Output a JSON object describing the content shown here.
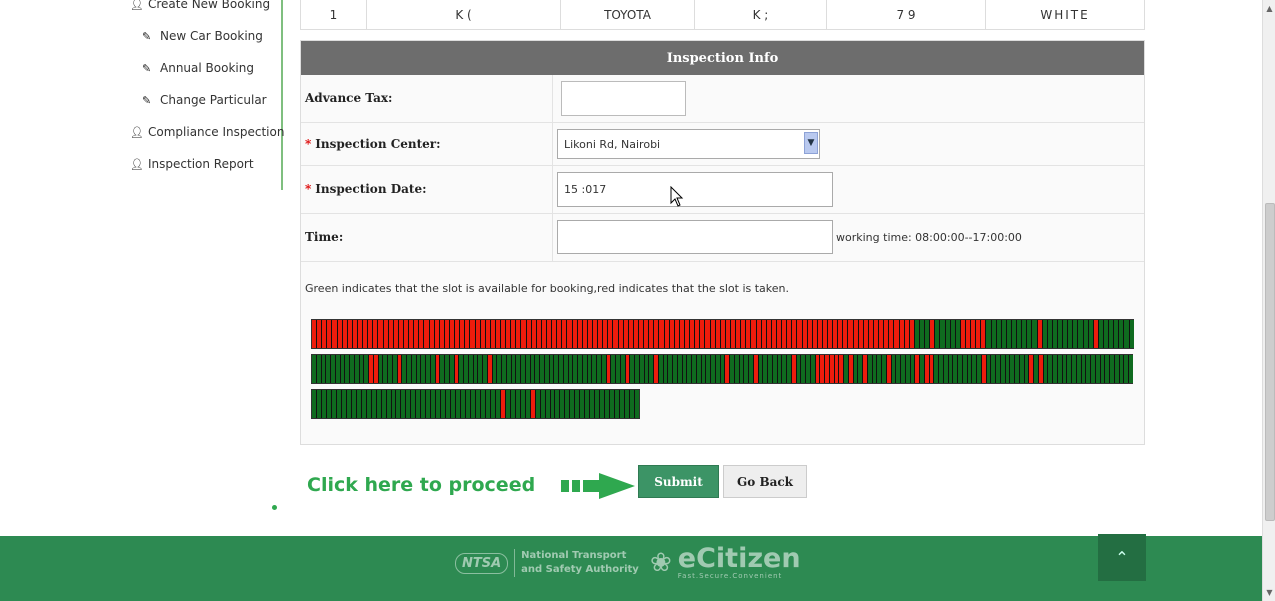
{
  "sidebar": {
    "items": [
      {
        "label": "Create New Booking",
        "icon": "user-icon"
      },
      {
        "label": "New Car Booking",
        "icon": "pencil-icon"
      },
      {
        "label": "Annual Booking",
        "icon": "pencil-icon"
      },
      {
        "label": "Change Particular",
        "icon": "pencil-icon"
      },
      {
        "label": "Compliance Inspection",
        "icon": "user-icon"
      },
      {
        "label": "Inspection Report",
        "icon": "user-icon"
      }
    ]
  },
  "vehicle_row": {
    "no": "1",
    "reg": "K      (",
    "make": "TOYOTA",
    "model": "K            ;",
    "chassis": "7            9",
    "color": "WHITE"
  },
  "inspection": {
    "title": "Inspection Info",
    "advance_tax_label": "Advance Tax:",
    "advance_tax_value": "",
    "center_label": "Inspection Center:",
    "center_value": "Likoni Rd, Nairobi",
    "date_label": "Inspection Date:",
    "date_value": "15      :017",
    "time_label": "Time:",
    "time_value": "",
    "working_time": "working time: 08:00:00--17:00:00",
    "required_marker": "*",
    "legend_text": "Green indicates that the slot is available for booking,red indicates that the slot is taken."
  },
  "slots": {
    "colors": {
      "available": "#0f6b1f",
      "taken": "#ee1c0c"
    },
    "row1": "RRRRRRRRRRRRRRRRRRRRRRRRRRRRRRRRRRRRRRRRRRRRRRRRRRRRRRRRRRRRRRRRRRRRRRRRRRRRRRRRRRRRRRRRRRRRRRRRRRRRRRRRRRRRRRRRRRRRRRGGGRGGGGGRRRRRGGGGGGGGGGRGGGGGGGGGGRGGGGGGG",
    "row2": "GGGGGGGGGGGGRRGGGGRGGGGGGGRGGGRGGGGGGRGGGGGGGGGGGGGGGGGGGGGGGGRGGGRGGGGGRGGGGGGGGGGGGGGRGGGGGRGGGGGGGRGGGGRRRRRRGRGGRGGGGRGGGGGRGRRGGGGGGGGGGRGGGGGGGGGRGRGGGGGGGGGGGGGGGGGGG",
    "row3": "GGGGGGGGGGGGGGGGGGGGGGGGGGGGGGGGGGGGGGRGGGGGRGGGGGGGGGGGGGGGGGGGGG"
  },
  "actions": {
    "hint": "Click here to proceed",
    "submit": "Submit",
    "go_back": "Go Back"
  },
  "footer": {
    "ntsa_logo": "NTSA",
    "ntsa_name_1": "National Transport",
    "ntsa_name_2": "and Safety Authority",
    "ecitizen": "eCitizen",
    "ecitizen_tag": "Fast.Secure.Convenient",
    "to_top_icon": "chevron-up-icon"
  }
}
